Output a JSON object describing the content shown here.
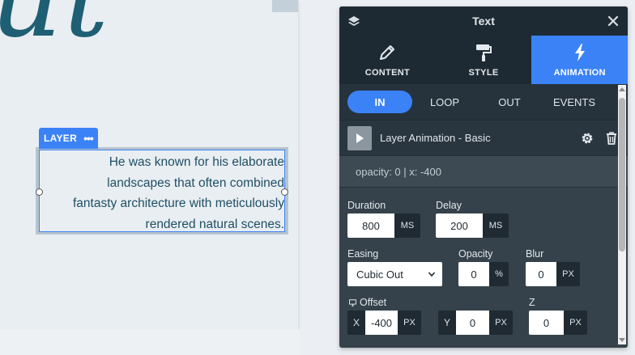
{
  "canvas": {
    "deco_text": "ut",
    "layer_tag": "LAYER",
    "layer_tag_menu": "•••",
    "text_lines": [
      "He was known for his elaborate",
      "landscapes that often combined",
      "fantasty architecture with meticulously",
      "rendered natural scenes."
    ]
  },
  "panel": {
    "title": "Text",
    "tabs": [
      {
        "label": "CONTENT",
        "icon": "pencil-icon"
      },
      {
        "label": "STYLE",
        "icon": "paint-roller-icon"
      },
      {
        "label": "ANIMATION",
        "icon": "lightning-icon",
        "active": true
      }
    ],
    "subtabs": [
      "IN",
      "LOOP",
      "OUT",
      "EVENTS"
    ],
    "active_subtab": "IN",
    "animation": {
      "label": "Layer Animation - Basic",
      "description": "opacity: 0 | x: -400"
    },
    "fields": {
      "duration": {
        "label": "Duration",
        "value": "800",
        "unit": "MS"
      },
      "delay": {
        "label": "Delay",
        "value": "200",
        "unit": "MS"
      },
      "easing": {
        "label": "Easing",
        "value": "Cubic Out"
      },
      "opacity": {
        "label": "Opacity",
        "value": "0",
        "unit": "%"
      },
      "blur": {
        "label": "Blur",
        "value": "0",
        "unit": "PX"
      },
      "offset": {
        "label": "Offset"
      },
      "z_label": "Z",
      "x": {
        "prefix": "X",
        "value": "-400",
        "unit": "PX"
      },
      "y": {
        "prefix": "Y",
        "value": "0",
        "unit": "PX"
      },
      "z": {
        "value": "0",
        "unit": "PX"
      }
    },
    "colors": {
      "accent": "#3b82f6",
      "panel_bg": "#35424b",
      "header_bg": "#1e2a33"
    }
  }
}
